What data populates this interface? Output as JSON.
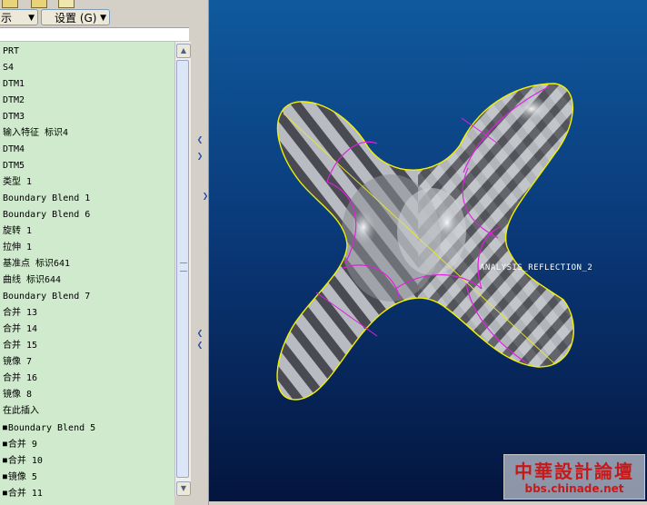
{
  "toolbar": {
    "filter_label": "示",
    "settings_label": "设置 (G)"
  },
  "tree": {
    "items": [
      {
        "label": "PRT",
        "bullet": false
      },
      {
        "label": "S4",
        "bullet": false
      },
      {
        "label": "DTM1",
        "bullet": false
      },
      {
        "label": "DTM2",
        "bullet": false
      },
      {
        "label": "DTM3",
        "bullet": false
      },
      {
        "label": "输入特征 标识4",
        "bullet": false
      },
      {
        "label": "DTM4",
        "bullet": false
      },
      {
        "label": "DTM5",
        "bullet": false
      },
      {
        "label": "类型 1",
        "bullet": false
      },
      {
        "label": "Boundary Blend 1",
        "bullet": false
      },
      {
        "label": "Boundary Blend 6",
        "bullet": false
      },
      {
        "label": "旋转 1",
        "bullet": false
      },
      {
        "label": "拉伸 1",
        "bullet": false
      },
      {
        "label": "基准点 标识641",
        "bullet": false
      },
      {
        "label": "曲线 标识644",
        "bullet": false
      },
      {
        "label": "Boundary Blend 7",
        "bullet": false
      },
      {
        "label": "合并 13",
        "bullet": false
      },
      {
        "label": "合并 14",
        "bullet": false
      },
      {
        "label": "合并 15",
        "bullet": false
      },
      {
        "label": "镜像 7",
        "bullet": false
      },
      {
        "label": "合并 16",
        "bullet": false
      },
      {
        "label": "镜像 8",
        "bullet": false
      },
      {
        "label": "在此插入",
        "bullet": false
      },
      {
        "label": "Boundary Blend 5",
        "bullet": true
      },
      {
        "label": "合并 9",
        "bullet": true
      },
      {
        "label": "合并 10",
        "bullet": true
      },
      {
        "label": "镜像 5",
        "bullet": true
      },
      {
        "label": "合并 11",
        "bullet": true
      }
    ]
  },
  "viewport": {
    "analysis_label": "ANALYSIS_REFLECTION_2",
    "watermark_cn": "中華設計論壇",
    "watermark_url": "bbs.chinade.net"
  },
  "icons": {
    "dropdown": "triangle-down",
    "scroll_up": "triangle-up",
    "scroll_down": "triangle-down",
    "sash": "chevron"
  },
  "colors": {
    "tree_bg": "#cfeacd",
    "viewport_top": "#0f5a9d",
    "viewport_bottom": "#04153e",
    "edge_yellow": "#f2f200",
    "curve_magenta": "#e020e0",
    "watermark_red": "#c61a1a"
  }
}
